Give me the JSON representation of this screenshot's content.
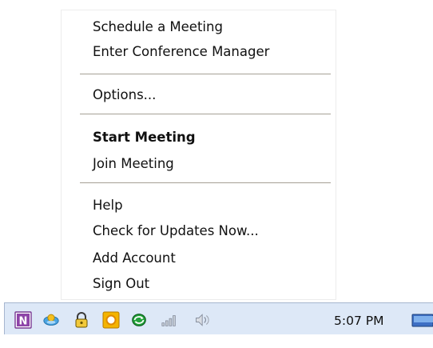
{
  "context_menu": {
    "items": [
      {
        "label": "Schedule a Meeting"
      },
      {
        "label": "Enter Conference Manager"
      },
      {
        "label": "Options..."
      },
      {
        "label": "Start Meeting",
        "default": true
      },
      {
        "label": "Join Meeting"
      },
      {
        "label": "Help"
      },
      {
        "label": "Check for Updates Now..."
      },
      {
        "label": "Add Account"
      },
      {
        "label": "Sign Out"
      }
    ]
  },
  "taskbar": {
    "tray_icons": [
      {
        "icon": "onenote-icon"
      },
      {
        "icon": "meeting-app-icon"
      },
      {
        "icon": "lock-icon"
      },
      {
        "icon": "outlook-icon"
      },
      {
        "icon": "green-sync-icon"
      },
      {
        "icon": "network-signal-icon"
      },
      {
        "icon": "speaker-icon"
      }
    ],
    "clock": "5:07 PM",
    "show_desktop_icon": "show-desktop-icon"
  }
}
